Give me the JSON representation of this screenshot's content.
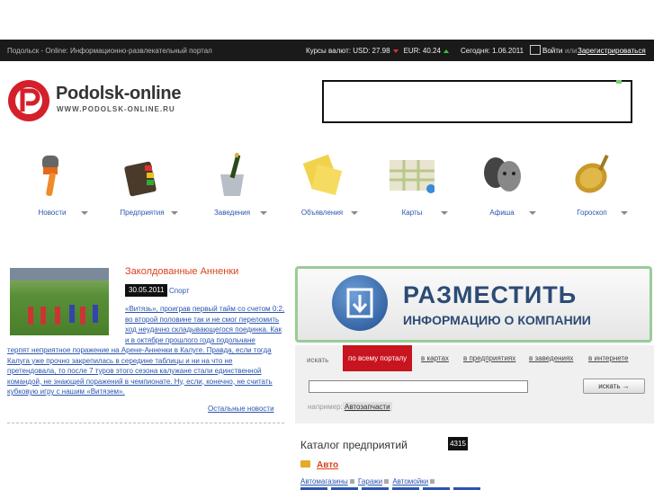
{
  "topbar": {
    "site_desc": "Подольск - Online: Информационно-развлекательный портал",
    "rates_label": "Курсы валют:",
    "usd": "USD: 27.98",
    "eur": "EUR: 40.24",
    "today": "Сегодня: 1.06.2011",
    "login": "Войти",
    "or": "или",
    "register": "Зарегистрироваться"
  },
  "logo": {
    "title": "Podolsk-online",
    "url": "WWW.PODOLSK-ONLINE.RU"
  },
  "nav": [
    "Новости",
    "Предприятия",
    "Заведения",
    "Объявления",
    "Карты",
    "Афиша",
    "Гороскоп"
  ],
  "news": {
    "title": "Заколдованные Анненки",
    "date": "30.05.2011",
    "category": "Спорт",
    "text1": "«Витязь», проиграв первый тайм со счетом 0:2, во второй половине так и не смог переломить ход неудачно складывающегося поединка. Как и в октябре прошлого года подольчане",
    "text2": "терпят неприятное поражение на Арене-Анненки в Калуге. Правда, если тогда Калуга уже прочно закрепилась в середине таблицы и ни на что не претендовала, то после 7 туров этого сезона калужане стали единственной командой, не знающей поражений в чемпионате. Ну, если, конечно, не считать кубковую игру с нашим «Витязем».",
    "other": "Остальные новости"
  },
  "promo": {
    "big": "РАЗМЕСТИТЬ",
    "small": "ИНФОРМАЦИЮ О КОМПАНИИ"
  },
  "search": {
    "label": "искать",
    "tabs": [
      "по всему порталу",
      "в картах",
      "в предприятиях",
      "в заведениях",
      "в интернете"
    ],
    "button": "искать →",
    "example_label": "например:",
    "example_value": "Автозапчасти"
  },
  "catalog": {
    "title": "Каталог предприятий",
    "count": "4315",
    "category": "Авто",
    "subs": [
      "Автомагазины",
      "Гаражи",
      "Автомойки"
    ]
  }
}
